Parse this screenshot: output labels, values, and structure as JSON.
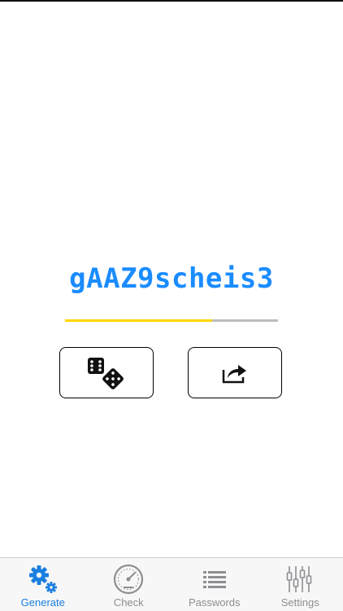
{
  "password": {
    "value": "gAAZ9scheis3",
    "strength": 0.69
  },
  "actions": {
    "generate_icon": "dice-icon",
    "share_icon": "share-icon"
  },
  "tabs": [
    {
      "label": "Generate",
      "icon": "gears-icon",
      "active": true
    },
    {
      "label": "Check",
      "icon": "speedometer-icon",
      "active": false
    },
    {
      "label": "Passwords",
      "icon": "list-icon",
      "active": false
    },
    {
      "label": "Settings",
      "icon": "sliders-icon",
      "active": false
    }
  ],
  "colors": {
    "accent": "#1a7fe0",
    "password_text": "#1a8cff",
    "strength_fill": "#ffd700",
    "strength_track": "#bdbdbd",
    "tab_inactive": "#8e8e93"
  }
}
